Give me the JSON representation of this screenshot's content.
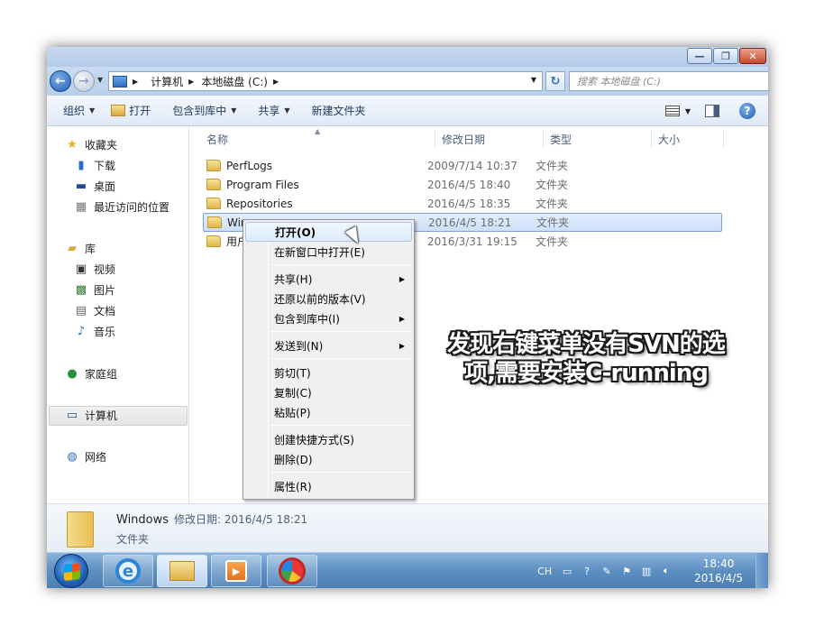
{
  "window": {
    "controls": {
      "minimize": "—",
      "maximize": "❐",
      "close": "✕"
    }
  },
  "address": {
    "crumbs": [
      "计算机",
      "本地磁盘 (C:)"
    ],
    "search_placeholder": "搜索 本地磁盘 (C:)"
  },
  "toolbar": {
    "organize": "组织",
    "open": "打开",
    "include_in_library": "包含到库中",
    "share": "共享",
    "new_folder": "新建文件夹"
  },
  "nav": {
    "favorites": "收藏夹",
    "downloads": "下载",
    "desktop": "桌面",
    "recent": "最近访问的位置",
    "libraries": "库",
    "videos": "视频",
    "pictures": "图片",
    "documents": "文档",
    "music": "音乐",
    "homegroup": "家庭组",
    "computer": "计算机",
    "network": "网络"
  },
  "columns": {
    "name": "名称",
    "date": "修改日期",
    "type": "类型",
    "size": "大小"
  },
  "files": [
    {
      "name": "PerfLogs",
      "date": "2009/7/14 10:37",
      "type": "文件夹"
    },
    {
      "name": "Program Files",
      "date": "2016/4/5 18:40",
      "type": "文件夹"
    },
    {
      "name": "Repositories",
      "date": "2016/4/5 18:35",
      "type": "文件夹"
    },
    {
      "name": "Win",
      "date": "2016/4/5 18:21",
      "type": "文件夹"
    },
    {
      "name": "用户",
      "date": "2016/3/31 19:15",
      "type": "文件夹"
    }
  ],
  "details": {
    "name": "Windows",
    "date_label": "修改日期: 2016/4/5 18:21",
    "type": "文件夹"
  },
  "context_menu": {
    "open": "打开(O)",
    "open_new_window": "在新窗口中打开(E)",
    "share": "共享(H)",
    "restore": "还原以前的版本(V)",
    "include": "包含到库中(I)",
    "send_to": "发送到(N)",
    "cut": "剪切(T)",
    "copy": "复制(C)",
    "paste": "粘贴(P)",
    "shortcut": "创建快捷方式(S)",
    "delete": "删除(D)",
    "properties": "属性(R)"
  },
  "taskbar": {
    "lang": "CH",
    "time": "18:40",
    "date": "2016/4/5"
  },
  "annotation": {
    "line1": "发现右键菜单没有SVN的选",
    "line2": "项,需要安装C-running"
  }
}
